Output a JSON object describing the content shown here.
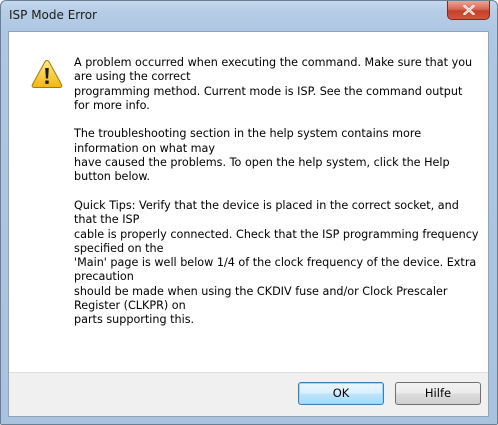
{
  "window": {
    "title": "ISP Mode Error"
  },
  "message": {
    "lines": [
      "A problem occurred when executing the command. Make sure that you",
      "are using the correct",
      "programming method. Current mode is ISP. See the command output",
      "for more info.",
      "",
      "The troubleshooting section in the help system contains more",
      "information on what may",
      "have caused the problems. To open the help system, click the Help",
      "button below.",
      "",
      "Quick Tips: Verify that the device is placed in the correct socket, and",
      "that the ISP",
      "cable is properly connected. Check that the ISP programming frequency",
      "specified on the",
      "'Main' page is well below 1/4 of the clock frequency of the device. Extra",
      "precaution",
      "should be made when using the CKDIV fuse and/or Clock Prescaler",
      "Register (CLKPR) on",
      "parts supporting this."
    ]
  },
  "buttons": {
    "ok_label": "OK",
    "help_label": "Hilfe"
  },
  "icons": {
    "warning": "warning-icon",
    "close": "close-icon"
  },
  "colors": {
    "warning_fill": "#f7c41f",
    "close_button": "#c4402a",
    "title_bar": "#b7cde6"
  }
}
